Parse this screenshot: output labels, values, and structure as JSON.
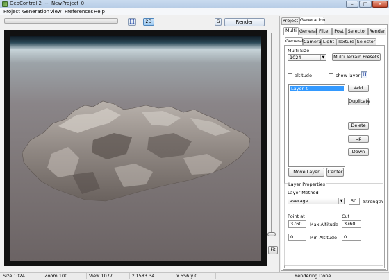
{
  "window": {
    "title": "GeoControl 2  --  NewProject_0",
    "controls": [
      "–",
      "□",
      "✕"
    ]
  },
  "menu": [
    "Project",
    "Generation",
    "View",
    "Preferences",
    "Help"
  ],
  "toolbar": {
    "progress": 0,
    "pause_icon": "pause-icon",
    "mode_2d": "2D",
    "g_label": "G",
    "render_label": "Render"
  },
  "viewport": {
    "fit_label": "Fit",
    "accent": "#3399ff"
  },
  "panel": {
    "top_tabs": [
      "Project",
      "Generation"
    ],
    "sub_tabs": [
      "Multi",
      "General",
      "Filter",
      "Post",
      "Selector",
      "Render"
    ],
    "inner_tabs": [
      "General",
      "Camera",
      "Light",
      "Texture",
      "Selector"
    ],
    "multi_size_label": "Multi Size",
    "multi_size_value": "1024",
    "presets_button": "Multi Terrain Presets",
    "altitude_label": "altitude",
    "show_layer_label": "show layer",
    "layers": [
      "Layer_0"
    ],
    "buttons": {
      "add": "Add",
      "duplicate": "Duplicate",
      "delete": "Delete",
      "up": "Up",
      "down": "Down",
      "move_layer": "Move Layer",
      "center": "Center"
    },
    "layer_properties": {
      "title": "Layer Properties",
      "method_label": "Layer Method",
      "method_value": "average",
      "strength_value": "50",
      "strength_label": "Strength",
      "point_at_label": "Point at",
      "cut_label": "Cut",
      "max_altitude_value": "3760",
      "max_altitude_label": "Max Altitude",
      "cut_value": "3760",
      "min_altitude_value": "0",
      "min_altitude_label": "Min Altitude",
      "cut_min_value": "0"
    }
  },
  "status": {
    "size": "Size 1024",
    "zoom": "Zoom  100",
    "view": "View  1077",
    "z": "z 1583.34",
    "xy": "x 556 y 0",
    "message": "Rendering Done"
  }
}
